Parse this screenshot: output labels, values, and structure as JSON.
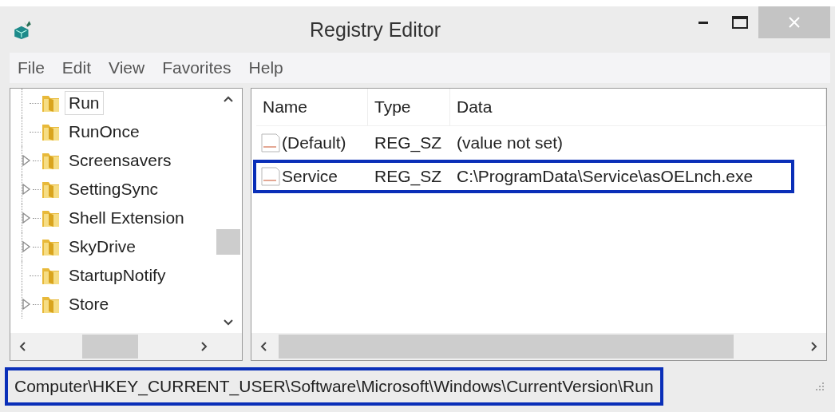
{
  "window": {
    "title": "Registry Editor"
  },
  "menu": [
    {
      "label": "File"
    },
    {
      "label": "Edit"
    },
    {
      "label": "View"
    },
    {
      "label": "Favorites"
    },
    {
      "label": "Help"
    }
  ],
  "tree": {
    "items": [
      {
        "label": "Run",
        "expandable": false,
        "selected": true
      },
      {
        "label": "RunOnce",
        "expandable": false,
        "selected": false
      },
      {
        "label": "Screensavers",
        "expandable": true,
        "selected": false
      },
      {
        "label": "SettingSync",
        "expandable": true,
        "selected": false
      },
      {
        "label": "Shell Extension",
        "expandable": true,
        "selected": false
      },
      {
        "label": "SkyDrive",
        "expandable": true,
        "selected": false
      },
      {
        "label": "StartupNotify",
        "expandable": false,
        "selected": false
      },
      {
        "label": "Store",
        "expandable": true,
        "selected": false
      }
    ]
  },
  "values": {
    "columns": [
      "Name",
      "Type",
      "Data"
    ],
    "rows": [
      {
        "name": "(Default)",
        "type": "REG_SZ",
        "data": "(value not set)",
        "highlighted": false
      },
      {
        "name": "Service",
        "type": "REG_SZ",
        "data": "C:\\ProgramData\\Service\\asOELnch.exe",
        "highlighted": true
      }
    ]
  },
  "status_bar": {
    "path": "Computer\\HKEY_CURRENT_USER\\Software\\Microsoft\\Windows\\CurrentVersion\\Run",
    "highlighted": true
  }
}
